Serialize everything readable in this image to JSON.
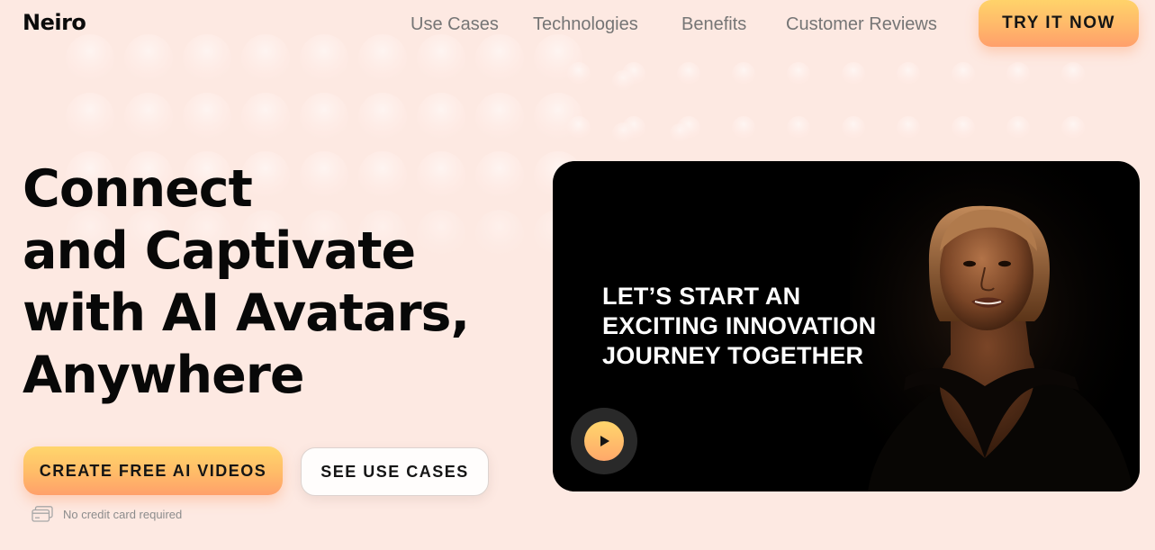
{
  "brand": {
    "logo": "Neiro"
  },
  "nav": {
    "items": [
      {
        "label": "Use Cases"
      },
      {
        "label": "Technologies"
      },
      {
        "label": "Benefits"
      },
      {
        "label": "Customer Reviews"
      }
    ],
    "cta_label": "TRY IT NOW"
  },
  "hero": {
    "title_lines": [
      "Connect",
      "and Captivate",
      "with AI Avatars,",
      "Anywhere"
    ],
    "primary_button": "CREATE FREE AI VIDEOS",
    "secondary_button": "SEE USE CASES",
    "note": "No credit card required",
    "note_icon": "credit-card-icon"
  },
  "video": {
    "caption_lines": [
      "LET’S START AN",
      "EXCITING INNOVATION",
      "JOURNEY TOGETHER"
    ],
    "play_icon": "play-icon"
  },
  "colors": {
    "background": "#fde9e2",
    "accent_start": "#ffd66c",
    "accent_end": "#ffa06a",
    "text": "#0b0b0b",
    "nav_text": "#757575",
    "video_bg": "#000000"
  }
}
